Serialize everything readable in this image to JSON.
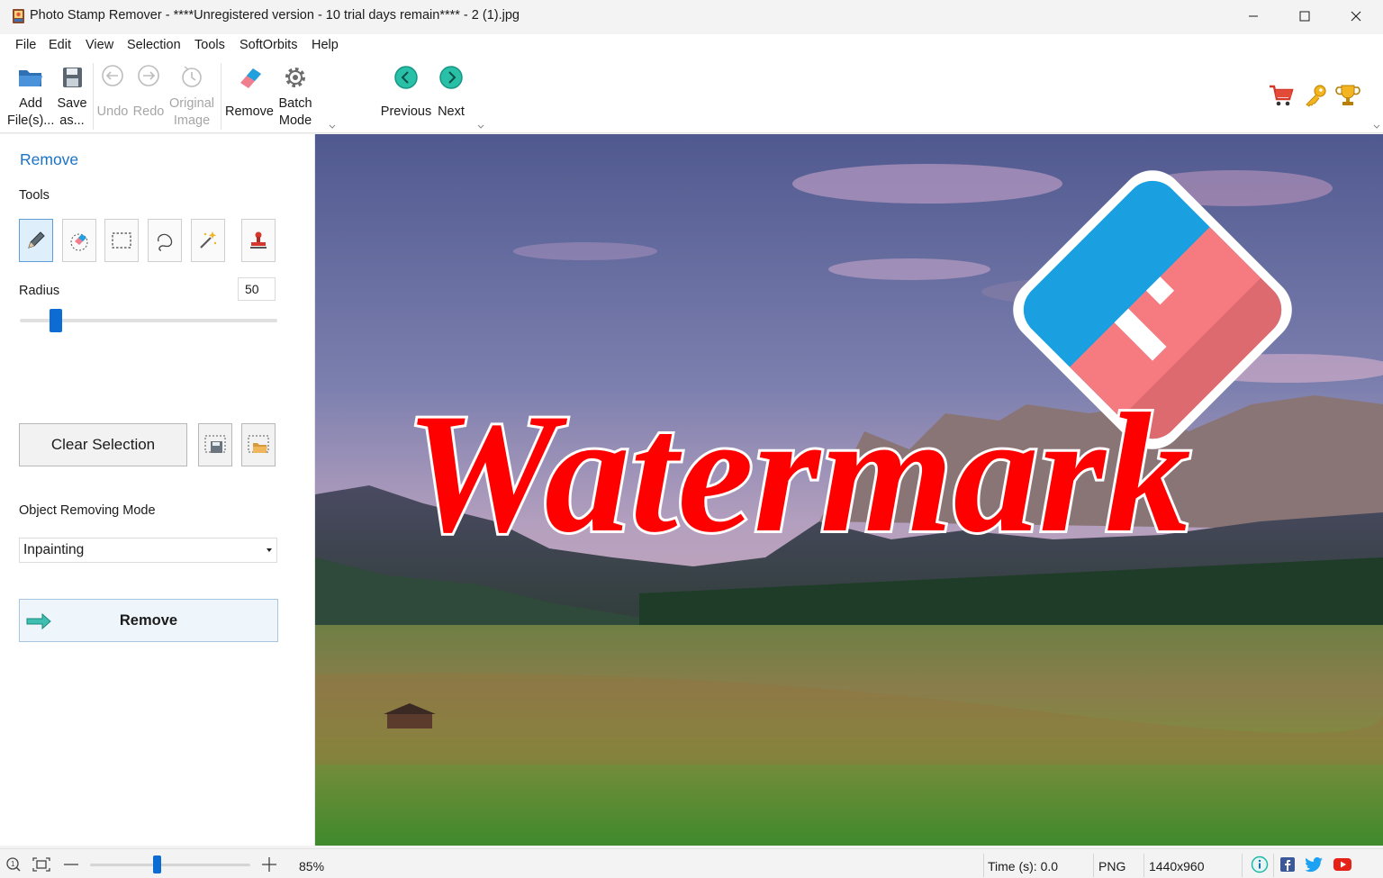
{
  "window": {
    "title": "Photo Stamp Remover - ****Unregistered version - 10 trial days remain**** - 2 (1).jpg"
  },
  "menu": [
    "File",
    "Edit",
    "View",
    "Selection",
    "Tools",
    "SoftOrbits",
    "Help"
  ],
  "toolbar": {
    "add_files": [
      "Add",
      "File(s)..."
    ],
    "save_as": [
      "Save",
      "as..."
    ],
    "undo": "Undo",
    "redo": "Redo",
    "original_image": [
      "Original",
      "Image"
    ],
    "remove": "Remove",
    "batch_mode": [
      "Batch",
      "Mode"
    ],
    "previous": "Previous",
    "next": "Next"
  },
  "panel": {
    "section_title": "Remove",
    "tools_label": "Tools",
    "radius_label": "Radius",
    "radius_value": "50",
    "radius_level": 0.12,
    "clear_selection": "Clear Selection",
    "mode_label": "Object Removing Mode",
    "mode_selected": "Inpainting",
    "remove_button": "Remove"
  },
  "canvas": {
    "watermark_text": "Watermark"
  },
  "status": {
    "zoom": "85%",
    "time": "Time (s): 0.0",
    "format": "PNG",
    "dimensions": "1440x960"
  },
  "colors": {
    "accent": "#1a73c7",
    "slider": "#0d6cd4",
    "watermark_red": "#ff0000",
    "nav_teal": "#1fb8a4"
  }
}
